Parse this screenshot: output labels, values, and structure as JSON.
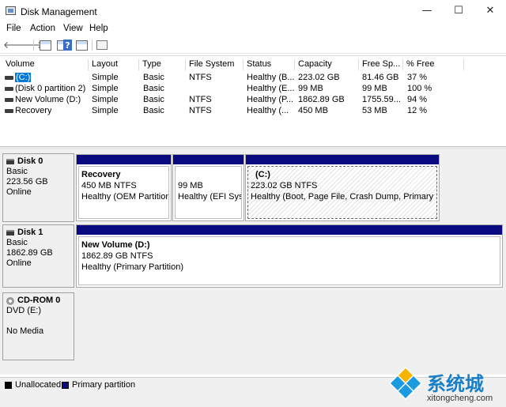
{
  "window": {
    "title": "Disk Management",
    "minimize": "—",
    "maximize": "☐",
    "close": "✕"
  },
  "menu": [
    "File",
    "Action",
    "View",
    "Help"
  ],
  "toolbar": {
    "back": "🡐",
    "forward": "🡒",
    "help": "?"
  },
  "volume_table": {
    "columns": [
      "Volume",
      "Layout",
      "Type",
      "File System",
      "Status",
      "Capacity",
      "Free Sp...",
      "% Free"
    ],
    "rows": [
      {
        "volume": "(C:)",
        "layout": "Simple",
        "type": "Basic",
        "fs": "NTFS",
        "status": "Healthy (B...",
        "capacity": "223.02 GB",
        "free": "81.46 GB",
        "pct": "37 %",
        "selected": true
      },
      {
        "volume": "(Disk 0 partition 2)",
        "layout": "Simple",
        "type": "Basic",
        "fs": "",
        "status": "Healthy (E...",
        "capacity": "99 MB",
        "free": "99 MB",
        "pct": "100 %"
      },
      {
        "volume": "New Volume (D:)",
        "layout": "Simple",
        "type": "Basic",
        "fs": "NTFS",
        "status": "Healthy (P...",
        "capacity": "1862.89 GB",
        "free": "1755.59...",
        "pct": "94 %"
      },
      {
        "volume": "Recovery",
        "layout": "Simple",
        "type": "Basic",
        "fs": "NTFS",
        "status": "Healthy (...",
        "capacity": "450 MB",
        "free": "53 MB",
        "pct": "12 %"
      }
    ]
  },
  "disks": [
    {
      "name": "Disk 0",
      "type": "Basic",
      "size": "223.56 GB",
      "state": "Online",
      "partitions": [
        {
          "name": "Recovery",
          "size": "450 MB NTFS",
          "status": "Healthy (OEM Partition)"
        },
        {
          "name": "",
          "size": "99 MB",
          "status": "Healthy (EFI System Partition)"
        },
        {
          "name": "(C:)",
          "size": "223.02 GB NTFS",
          "status": "Healthy (Boot, Page File, Crash Dump, Primary Partition)"
        }
      ]
    },
    {
      "name": "Disk 1",
      "type": "Basic",
      "size": "1862.89 GB",
      "state": "Online",
      "partitions": [
        {
          "name": "New Volume  (D:)",
          "size": "1862.89 GB NTFS",
          "status": "Healthy (Primary Partition)"
        }
      ]
    },
    {
      "name": "CD-ROM 0",
      "type": "DVD (E:)",
      "size": "",
      "state": "No Media"
    }
  ],
  "legend": {
    "unallocated": "Unallocated",
    "unallocated_color": "#000000",
    "primary": "Primary partition",
    "primary_color": "#0a0a80"
  },
  "watermark": {
    "cn": "系统城",
    "en": "xitongcheng.com"
  }
}
